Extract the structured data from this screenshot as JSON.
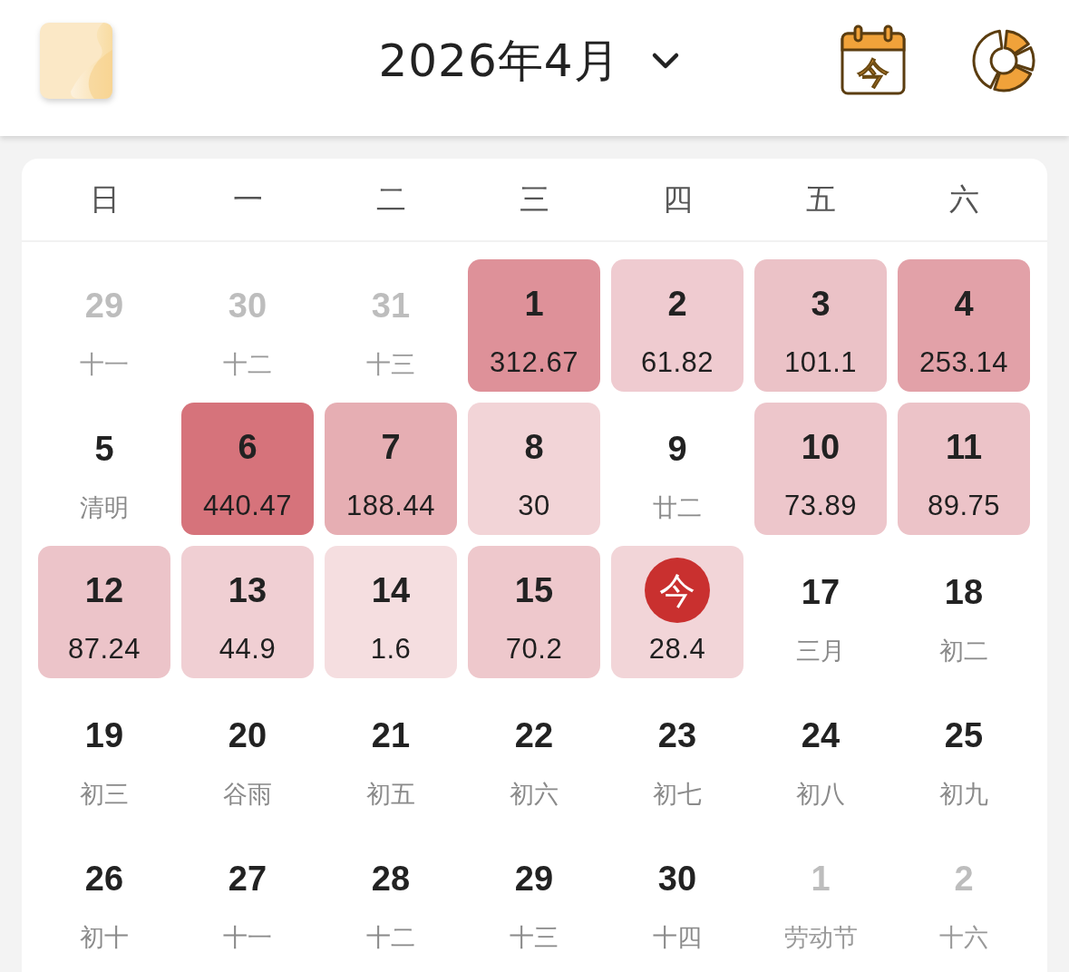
{
  "header": {
    "title": "2026年4月",
    "today_button": "今"
  },
  "weekdays": [
    "日",
    "一",
    "二",
    "三",
    "四",
    "五",
    "六"
  ],
  "days": [
    {
      "kind": "plain",
      "number": "29",
      "lunar": "十一",
      "outside": true
    },
    {
      "kind": "plain",
      "number": "30",
      "lunar": "十二",
      "outside": true
    },
    {
      "kind": "plain",
      "number": "31",
      "lunar": "十三",
      "outside": true
    },
    {
      "kind": "spent",
      "number": "1",
      "amount": "312.67",
      "color": "#de9199",
      "outside": false
    },
    {
      "kind": "spent",
      "number": "2",
      "amount": "61.82",
      "color": "#efcbd0",
      "outside": false
    },
    {
      "kind": "spent",
      "number": "3",
      "amount": "101.1",
      "color": "#ebc2c7",
      "outside": false
    },
    {
      "kind": "spent",
      "number": "4",
      "amount": "253.14",
      "color": "#e2a1a8",
      "outside": false
    },
    {
      "kind": "plain",
      "number": "5",
      "lunar": "清明",
      "outside": false
    },
    {
      "kind": "spent",
      "number": "6",
      "amount": "440.47",
      "color": "#d6737b",
      "outside": false
    },
    {
      "kind": "spent",
      "number": "7",
      "amount": "188.44",
      "color": "#e6aeb3",
      "outside": false
    },
    {
      "kind": "spent",
      "number": "8",
      "amount": "30",
      "color": "#f2d4d7",
      "outside": false
    },
    {
      "kind": "plain",
      "number": "9",
      "lunar": "廿二",
      "outside": false
    },
    {
      "kind": "spent",
      "number": "10",
      "amount": "73.89",
      "color": "#edc6cb",
      "outside": false
    },
    {
      "kind": "spent",
      "number": "11",
      "amount": "89.75",
      "color": "#ecc3c8",
      "outside": false
    },
    {
      "kind": "spent",
      "number": "12",
      "amount": "87.24",
      "color": "#ecc4c9",
      "outside": false
    },
    {
      "kind": "spent",
      "number": "13",
      "amount": "44.9",
      "color": "#f0cfd3",
      "outside": false
    },
    {
      "kind": "spent",
      "number": "14",
      "amount": "1.6",
      "color": "#f5dee0",
      "outside": false
    },
    {
      "kind": "spent",
      "number": "15",
      "amount": "70.2",
      "color": "#eec8cc",
      "outside": false
    },
    {
      "kind": "today",
      "badge": "今",
      "amount": "28.4",
      "color": "#f2d5d8",
      "outside": false
    },
    {
      "kind": "plain",
      "number": "17",
      "lunar": "三月",
      "outside": false
    },
    {
      "kind": "plain",
      "number": "18",
      "lunar": "初二",
      "outside": false
    },
    {
      "kind": "plain",
      "number": "19",
      "lunar": "初三",
      "outside": false
    },
    {
      "kind": "plain",
      "number": "20",
      "lunar": "谷雨",
      "outside": false
    },
    {
      "kind": "plain",
      "number": "21",
      "lunar": "初五",
      "outside": false
    },
    {
      "kind": "plain",
      "number": "22",
      "lunar": "初六",
      "outside": false
    },
    {
      "kind": "plain",
      "number": "23",
      "lunar": "初七",
      "outside": false
    },
    {
      "kind": "plain",
      "number": "24",
      "lunar": "初八",
      "outside": false
    },
    {
      "kind": "plain",
      "number": "25",
      "lunar": "初九",
      "outside": false
    },
    {
      "kind": "plain",
      "number": "26",
      "lunar": "初十",
      "outside": false
    },
    {
      "kind": "plain",
      "number": "27",
      "lunar": "十一",
      "outside": false
    },
    {
      "kind": "plain",
      "number": "28",
      "lunar": "十二",
      "outside": false
    },
    {
      "kind": "plain",
      "number": "29",
      "lunar": "十三",
      "outside": false
    },
    {
      "kind": "plain",
      "number": "30",
      "lunar": "十四",
      "outside": false
    },
    {
      "kind": "plain",
      "number": "1",
      "lunar": "劳动节",
      "outside": true
    },
    {
      "kind": "plain",
      "number": "2",
      "lunar": "十六",
      "outside": true
    }
  ]
}
